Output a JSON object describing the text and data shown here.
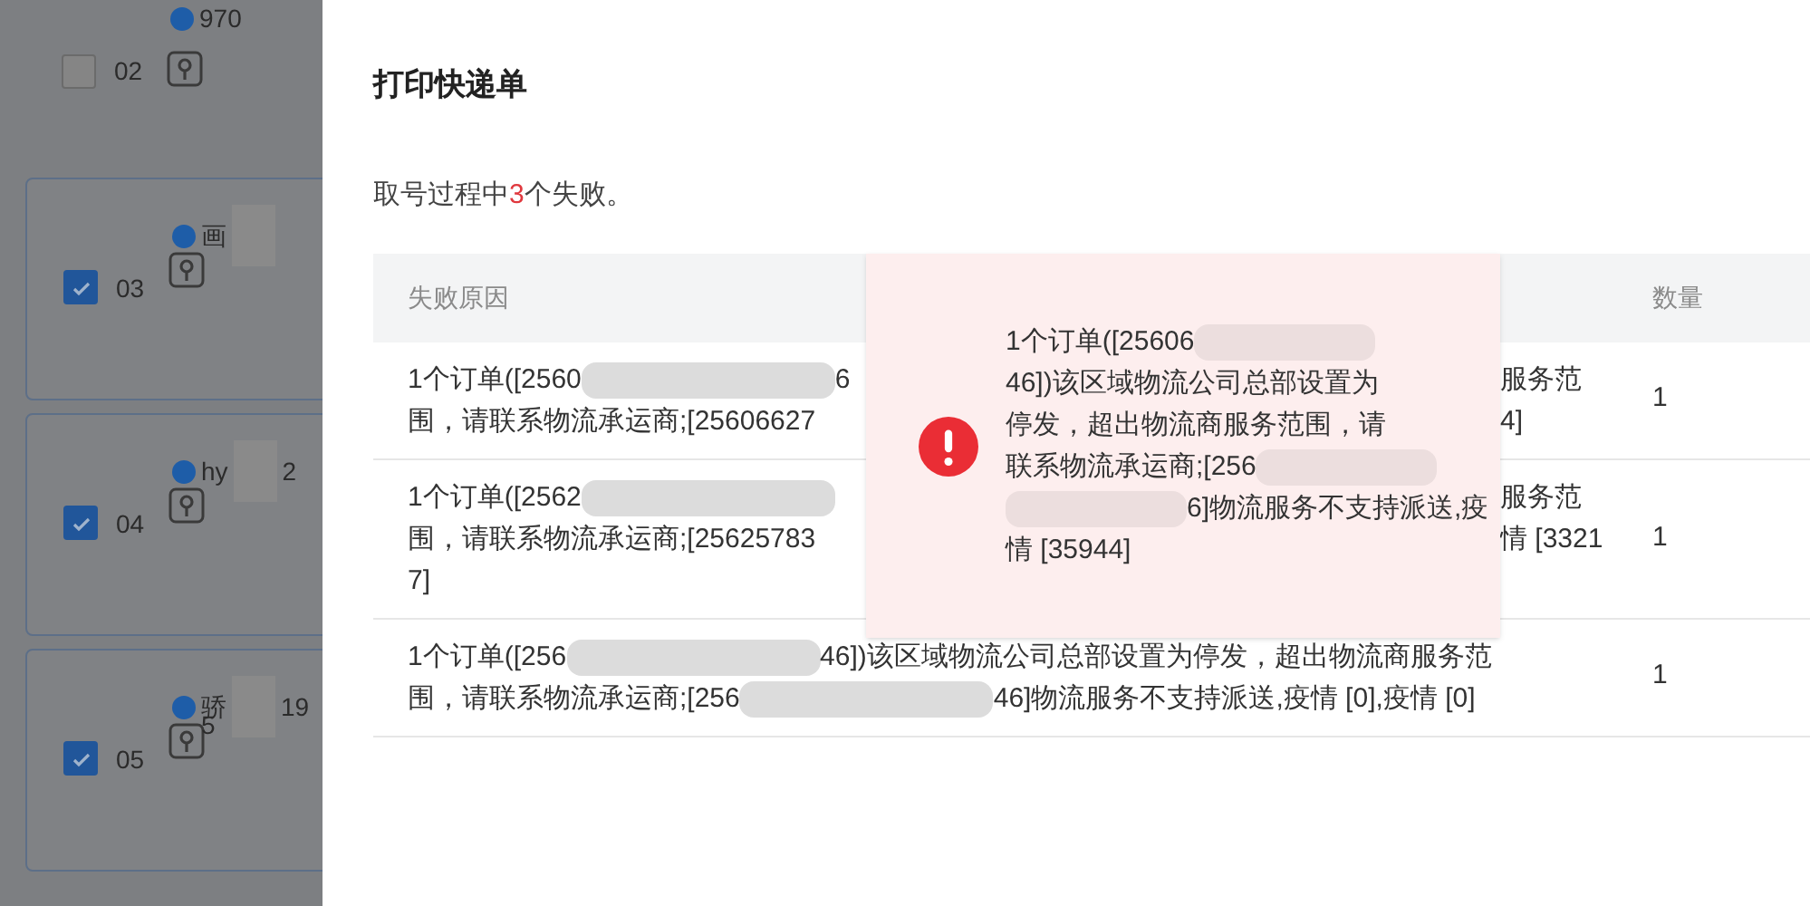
{
  "sidebar": {
    "items": [
      {
        "number": "02",
        "checked": false,
        "name_parts": [
          {
            "kind": "text",
            "text": "970"
          }
        ],
        "carded": false
      },
      {
        "number": "03",
        "checked": true,
        "name_parts": [
          {
            "kind": "text",
            "text": "画"
          },
          {
            "kind": "redacted"
          }
        ],
        "carded": true
      },
      {
        "number": "04",
        "checked": true,
        "name_parts": [
          {
            "kind": "text",
            "text": "hy"
          },
          {
            "kind": "redacted"
          },
          {
            "kind": "text",
            "text": "2"
          }
        ],
        "carded": true
      },
      {
        "number": "05",
        "checked": true,
        "name_parts": [
          {
            "kind": "text",
            "text": "骄"
          },
          {
            "kind": "redacted"
          },
          {
            "kind": "text",
            "text": "19"
          }
        ],
        "name_second_line": "5",
        "carded": true
      }
    ]
  },
  "dialog": {
    "title": "打印快递单",
    "summary": {
      "before": "取号过程中",
      "count": "3",
      "after": "个失败。"
    },
    "table": {
      "columns": [
        "失败原因",
        "数量"
      ],
      "rows": [
        {
          "lines": [
            {
              "segments": [
                {
                  "kind": "text",
                  "text": "1个订单([2560"
                },
                {
                  "kind": "redacted"
                },
                {
                  "kind": "text",
                  "text": "6"
                }
              ],
              "right": "服务范"
            },
            {
              "segments": [
                {
                  "kind": "text",
                  "text": "围，请联系物流承运商;[25606627"
                }
              ],
              "right": "4]"
            }
          ],
          "quantity": "1"
        },
        {
          "lines": [
            {
              "segments": [
                {
                  "kind": "text",
                  "text": "1个订单([2562"
                },
                {
                  "kind": "redacted"
                }
              ],
              "right": "服务范"
            },
            {
              "segments": [
                {
                  "kind": "text",
                  "text": "围，请联系物流承运商;[25625783"
                }
              ],
              "right": "情 [3321"
            },
            {
              "segments": [
                {
                  "kind": "text",
                  "text": "7]"
                }
              ]
            }
          ],
          "quantity": "1"
        },
        {
          "lines": [
            {
              "segments": [
                {
                  "kind": "text",
                  "text": "1个订单([256"
                },
                {
                  "kind": "redacted"
                },
                {
                  "kind": "text",
                  "text": "46])该区域物流公司总部设置为停发，超出物流商服务范"
                }
              ]
            },
            {
              "segments": [
                {
                  "kind": "text",
                  "text": "围，请联系物流承运商;[256"
                },
                {
                  "kind": "redacted"
                },
                {
                  "kind": "text",
                  "text": "46]物流服务不支持派送,疫情 [0],疫情 [0]"
                }
              ]
            }
          ],
          "quantity": "1"
        }
      ]
    },
    "tooltip": {
      "lines": [
        {
          "segments": [
            {
              "kind": "text",
              "text": "1个订单([25606"
            },
            {
              "kind": "redacted"
            }
          ]
        },
        {
          "segments": [
            {
              "kind": "text",
              "text": "46])该区域物流公司总部设置为"
            }
          ]
        },
        {
          "segments": [
            {
              "kind": "text",
              "text": "停发，超出物流商服务范围，请"
            }
          ]
        },
        {
          "segments": [
            {
              "kind": "text",
              "text": "联系物流承运商;[256"
            },
            {
              "kind": "redacted"
            }
          ]
        },
        {
          "segments": [
            {
              "kind": "redacted"
            },
            {
              "kind": "text",
              "text": "6]物流服务不支持派送,疫"
            }
          ]
        },
        {
          "segments": [
            {
              "kind": "text",
              "text": "情 [35944]"
            }
          ]
        }
      ]
    }
  }
}
